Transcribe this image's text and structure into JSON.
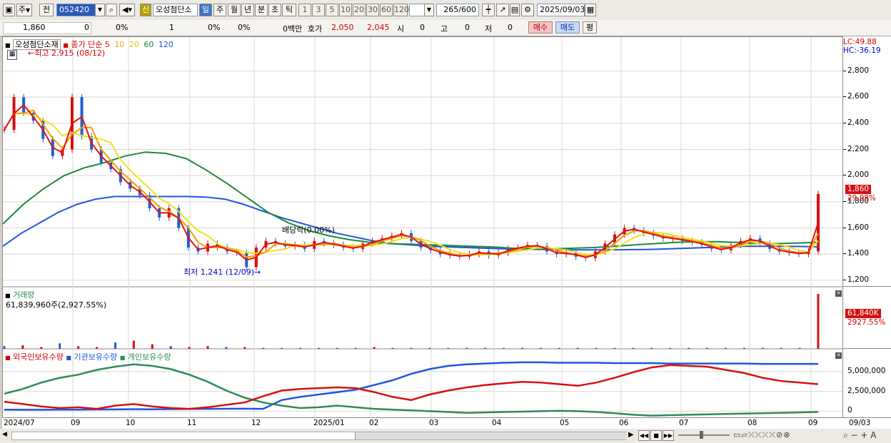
{
  "toolbar": {
    "period_type": "주",
    "period_prev": "전",
    "stock_code": "052420",
    "new_label": "신",
    "stock_name": "오성첨단소",
    "tabs": [
      "일",
      "주",
      "월",
      "년",
      "분",
      "초",
      "틱"
    ],
    "selected_tab": "일",
    "intervals": [
      "1",
      "3",
      "5",
      "10",
      "20",
      "30",
      "60",
      "120"
    ],
    "count": "265",
    "count_max": "/600",
    "date": "2025/09/03"
  },
  "quote": {
    "price": "1,860",
    "change": "0",
    "change_pct": "0%",
    "volume": "1",
    "v1": "0%",
    "v2": "0%",
    "amount": "0백만",
    "ask_label": "호가",
    "ask": "2,050",
    "bid": "2,045",
    "open_label": "시",
    "open": "0",
    "high_label": "고",
    "high": "0",
    "low_label": "저",
    "low": "0",
    "buy_button": "매수",
    "sell_button": "매도",
    "eval_button": "평"
  },
  "price_panel": {
    "name": "오성첨단소재",
    "ma_label": "종가 단순",
    "ma_periods": [
      "5",
      "10",
      "20",
      "60",
      "120"
    ],
    "ma_colors": [
      "#e81010",
      "#f5a000",
      "#f0e020",
      "#1a8a3a",
      "#2255dd"
    ],
    "high_marker": "최고 2,915 (08/12)",
    "low_marker": "최저 1,241 (12/09)",
    "dividend_marker": "배당락(0.00%)",
    "lc": "LC:49.88",
    "hc": "HC:-36.19",
    "price_badge": "1,860",
    "pct_badge": "29.98%"
  },
  "volume_panel": {
    "title": "거래량",
    "value": "61,839,960주(2,927.55%)",
    "badge_value": "61,840K",
    "badge_pct": "2927.55%"
  },
  "holdings_panel": {
    "legend": [
      "외국인보유수량",
      "기관보유수량",
      "개인보유수량"
    ],
    "colors": [
      "#d71010",
      "#2255dd",
      "#2e8b57"
    ]
  },
  "chart_data": {
    "type": "line",
    "price_axis": [
      "2,800",
      "2,600",
      "2,400",
      "2,200",
      "2,000",
      "1,800",
      "1,600",
      "1,400",
      "1,200"
    ],
    "holdings_axis": [
      "5,000,000",
      "2,500,000",
      "0"
    ],
    "x_labels": [
      "2024/07",
      "09",
      "10",
      "11",
      "12",
      "2025/01",
      "02",
      "03",
      "04",
      "05",
      "06",
      "07",
      "08",
      "09",
      "09/03"
    ],
    "close": [
      2350,
      2600,
      2480,
      2420,
      2280,
      2150,
      2200,
      2600,
      2300,
      2200,
      2100,
      2050,
      1950,
      1900,
      1850,
      1750,
      1680,
      1750,
      1600,
      1450,
      1420,
      1480,
      1450,
      1420,
      1410,
      1300,
      1450,
      1500,
      1480,
      1460,
      1470,
      1440,
      1500,
      1480,
      1470,
      1450,
      1440,
      1480,
      1500,
      1520,
      1540,
      1560,
      1500,
      1450,
      1430,
      1400,
      1390,
      1380,
      1400,
      1420,
      1390,
      1410,
      1440,
      1450,
      1470,
      1460,
      1420,
      1400,
      1410,
      1380,
      1370,
      1420,
      1480,
      1550,
      1600,
      1580,
      1560,
      1540,
      1520,
      1520,
      1500,
      1490,
      1470,
      1440,
      1430,
      1470,
      1500,
      1520,
      1480,
      1440,
      1420,
      1410,
      1400,
      1420,
      1860
    ],
    "ma120": [
      1460,
      1560,
      1640,
      1720,
      1780,
      1820,
      1840,
      1840,
      1840,
      1840,
      1840,
      1835,
      1820,
      1780,
      1730,
      1680,
      1640,
      1600,
      1560,
      1530,
      1500,
      1480,
      1470,
      1460,
      1455,
      1450,
      1445,
      1440,
      1438,
      1436,
      1434,
      1432,
      1432,
      1432,
      1434,
      1436,
      1440,
      1445,
      1450,
      1455,
      1460,
      1460,
      1460,
      1458,
      1455
    ],
    "ma60": [
      1630,
      1780,
      1900,
      2000,
      2060,
      2100,
      2150,
      2180,
      2170,
      2130,
      2040,
      1940,
      1830,
      1720,
      1640,
      1580,
      1540,
      1510,
      1490,
      1480,
      1475,
      1470,
      1465,
      1460,
      1455,
      1445,
      1440,
      1440,
      1445,
      1450,
      1460,
      1470,
      1480,
      1490,
      1495,
      1495,
      1490,
      1480,
      1480,
      1485,
      1490
    ],
    "volume": [
      3,
      4,
      2,
      6,
      3,
      2,
      7,
      9,
      5,
      3,
      2,
      3,
      2,
      2,
      1,
      1,
      1,
      1,
      1,
      1,
      2,
      1,
      1,
      1,
      1,
      1,
      1,
      1,
      1,
      1,
      1,
      1,
      1,
      1,
      1,
      1,
      1,
      1,
      1,
      1,
      1,
      1,
      1,
      1,
      60
    ],
    "foreign": [
      1200,
      900,
      600,
      400,
      500,
      300,
      700,
      900,
      600,
      400,
      300,
      500,
      800,
      1100,
      1900,
      2600,
      2800,
      2900,
      3000,
      2900,
      2400,
      1800,
      1400,
      2100,
      2600,
      3000,
      3300,
      3500,
      3700,
      3600,
      3400,
      3200,
      3600,
      4200,
      4900,
      5500,
      5800,
      5700,
      5600,
      5200,
      4800,
      4200,
      3800,
      3600,
      3400
    ],
    "institution": [
      200,
      180,
      180,
      190,
      200,
      220,
      230,
      250,
      240,
      260,
      280,
      300,
      310,
      320,
      300,
      1400,
      1800,
      2100,
      2400,
      2700,
      3300,
      3900,
      4700,
      5300,
      5700,
      5900,
      6000,
      6100,
      6150,
      6150,
      6100,
      6100,
      6100,
      6050,
      6050,
      6050,
      6000,
      6000,
      6000,
      6000,
      6000,
      5950,
      5950,
      5950,
      5950
    ],
    "retail": [
      2200,
      2800,
      3600,
      4200,
      4600,
      5200,
      5600,
      5900,
      5700,
      5300,
      4600,
      3700,
      2600,
      1700,
      1100,
      700,
      400,
      500,
      700,
      500,
      300,
      200,
      100,
      0,
      -100,
      -200,
      -150,
      -100,
      -50,
      0,
      50,
      0,
      -100,
      -250,
      -450,
      -550,
      -500,
      -450,
      -400,
      -350,
      -300,
      -250,
      -200,
      -150,
      -100
    ]
  }
}
